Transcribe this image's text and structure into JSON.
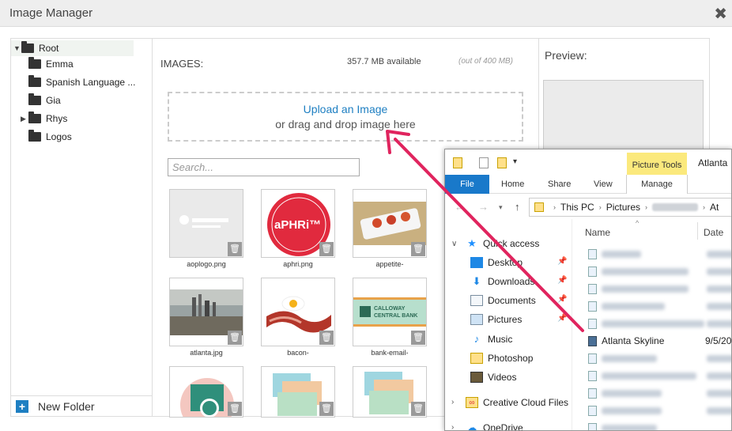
{
  "dialog": {
    "title": "Image Manager",
    "close_icon": "close-icon"
  },
  "tree": {
    "root": "Root",
    "folders": [
      "Emma",
      "Spanish Language ...",
      "Gia",
      "Rhys",
      "Logos"
    ],
    "new_folder": "New Folder"
  },
  "images": {
    "label": "IMAGES:",
    "available": "357.7 MB available",
    "quota": "(out of 400 MB)",
    "upload_link": "Upload an Image",
    "drag_text": "or drag and drop image here",
    "search_placeholder": "Search...",
    "thumbnails": [
      {
        "caption": "aoplogo.png"
      },
      {
        "caption": "aphri.png",
        "logo_text": "aPHRi™"
      },
      {
        "caption": "appetite-"
      },
      {
        "caption": "atlanta.jpg"
      },
      {
        "caption": "bacon-"
      },
      {
        "caption": "bank-email-",
        "logo_text": "CALLOWAY CENTRAL BANK"
      },
      {
        "caption": ""
      },
      {
        "caption": ""
      },
      {
        "caption": ""
      }
    ]
  },
  "preview": {
    "label": "Preview:"
  },
  "explorer": {
    "picture_tools": "Picture Tools",
    "window_title": "Atlanta",
    "tabs": [
      "File",
      "Home",
      "Share",
      "View",
      "Manage"
    ],
    "breadcrumb": [
      "This PC",
      "Pictures",
      "At"
    ],
    "nav": {
      "quick_access": "Quick access",
      "items": [
        "Desktop",
        "Downloads",
        "Documents",
        "Pictures",
        "Music",
        "Photoshop",
        "Videos"
      ],
      "creative_cloud": "Creative Cloud Files",
      "onedrive": "OneDrive"
    },
    "columns": {
      "name": "Name",
      "date": "Date"
    },
    "selected_file": {
      "name": "Atlanta Skyline",
      "date": "9/5/20"
    }
  },
  "colors": {
    "accent": "#1e7fc2",
    "arrow": "#e0245e",
    "file_tab": "#1979ca",
    "picture_tools": "#fbe97d"
  }
}
